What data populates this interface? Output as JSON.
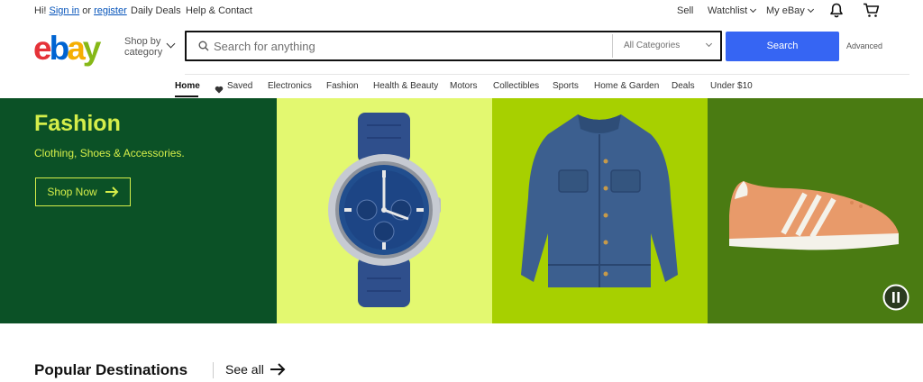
{
  "topbar": {
    "greeting_prefix": "Hi!",
    "sign_in": "Sign in",
    "or": "or",
    "register": "register",
    "daily_deals": "Daily Deals",
    "help_contact": "Help & Contact",
    "sell": "Sell",
    "watchlist": "Watchlist",
    "my_ebay": "My eBay"
  },
  "header": {
    "logo_letters": [
      "e",
      "b",
      "a",
      "y"
    ],
    "logo_colors": [
      "#e53238",
      "#0064d2",
      "#f5af02",
      "#86b817"
    ],
    "shop_by_line1": "Shop by",
    "shop_by_line2": "category",
    "search_placeholder": "Search for anything",
    "category_selected": "All Categories",
    "search_button": "Search",
    "advanced": "Advanced"
  },
  "nav": {
    "items": [
      "Home",
      "Saved",
      "Electronics",
      "Fashion",
      "Health & Beauty",
      "Motors",
      "Collectibles",
      "Sports",
      "Home & Garden",
      "Deals",
      "Under $10"
    ]
  },
  "banner": {
    "title": "Fashion",
    "subtitle": "Clothing, Shoes & Accessories.",
    "cta": "Shop Now",
    "colors": {
      "panel1": "#0b5126",
      "panel2": "#e3f870",
      "panel3": "#a7d000",
      "panel4": "#4a7b12",
      "accent": "#d5ee4a"
    }
  },
  "popular": {
    "title": "Popular Destinations",
    "see_all": "See all"
  },
  "colors": {
    "link": "#0654ba",
    "primary_button": "#3665f3"
  }
}
